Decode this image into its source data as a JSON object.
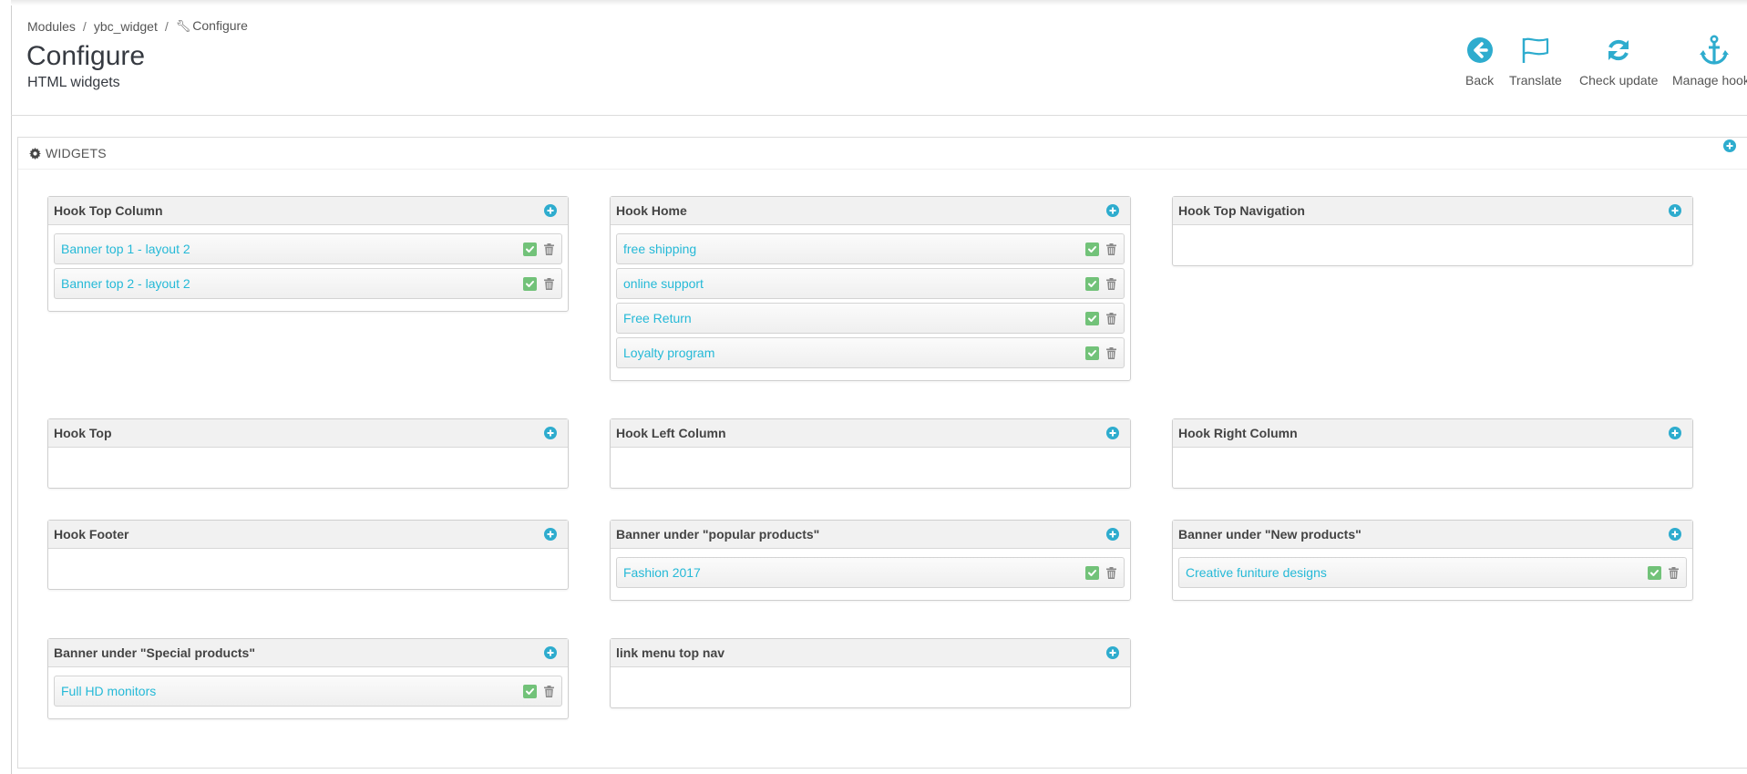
{
  "breadcrumb": {
    "item1": "Modules",
    "sep": "/",
    "item2": "ybc_widget",
    "item3": "Configure"
  },
  "page": {
    "title": "Configure",
    "subtitle": "HTML widgets"
  },
  "toolbar": {
    "back": "Back",
    "translate": "Translate",
    "check_update": "Check update",
    "manage_hooks": "Manage hooks"
  },
  "panel": {
    "title": "WIDGETS"
  },
  "colors": {
    "accent": "#25b9d7",
    "check": "#72c279",
    "icon_blue": "#2eacce"
  },
  "hooks": [
    {
      "title": "Hook Top Column",
      "items": [
        "Banner top 1 - layout 2",
        "Banner top 2 - layout 2"
      ]
    },
    {
      "title": "Hook Home",
      "items": [
        "free shipping",
        "online support",
        "Free Return",
        "Loyalty program"
      ]
    },
    {
      "title": "Hook Top Navigation",
      "items": []
    },
    {
      "title": "Hook Top",
      "items": []
    },
    {
      "title": "Hook Left Column",
      "items": []
    },
    {
      "title": "Hook Right Column",
      "items": []
    },
    {
      "title": "Hook Footer",
      "items": []
    },
    {
      "title": "Banner under \"popular products\"",
      "items": [
        "Fashion 2017"
      ]
    },
    {
      "title": "Banner under \"New products\"",
      "items": [
        "Creative funiture designs"
      ]
    },
    {
      "title": "Banner under \"Special products\"",
      "items": [
        "Full HD monitors"
      ]
    },
    {
      "title": "link menu top nav",
      "items": []
    }
  ]
}
